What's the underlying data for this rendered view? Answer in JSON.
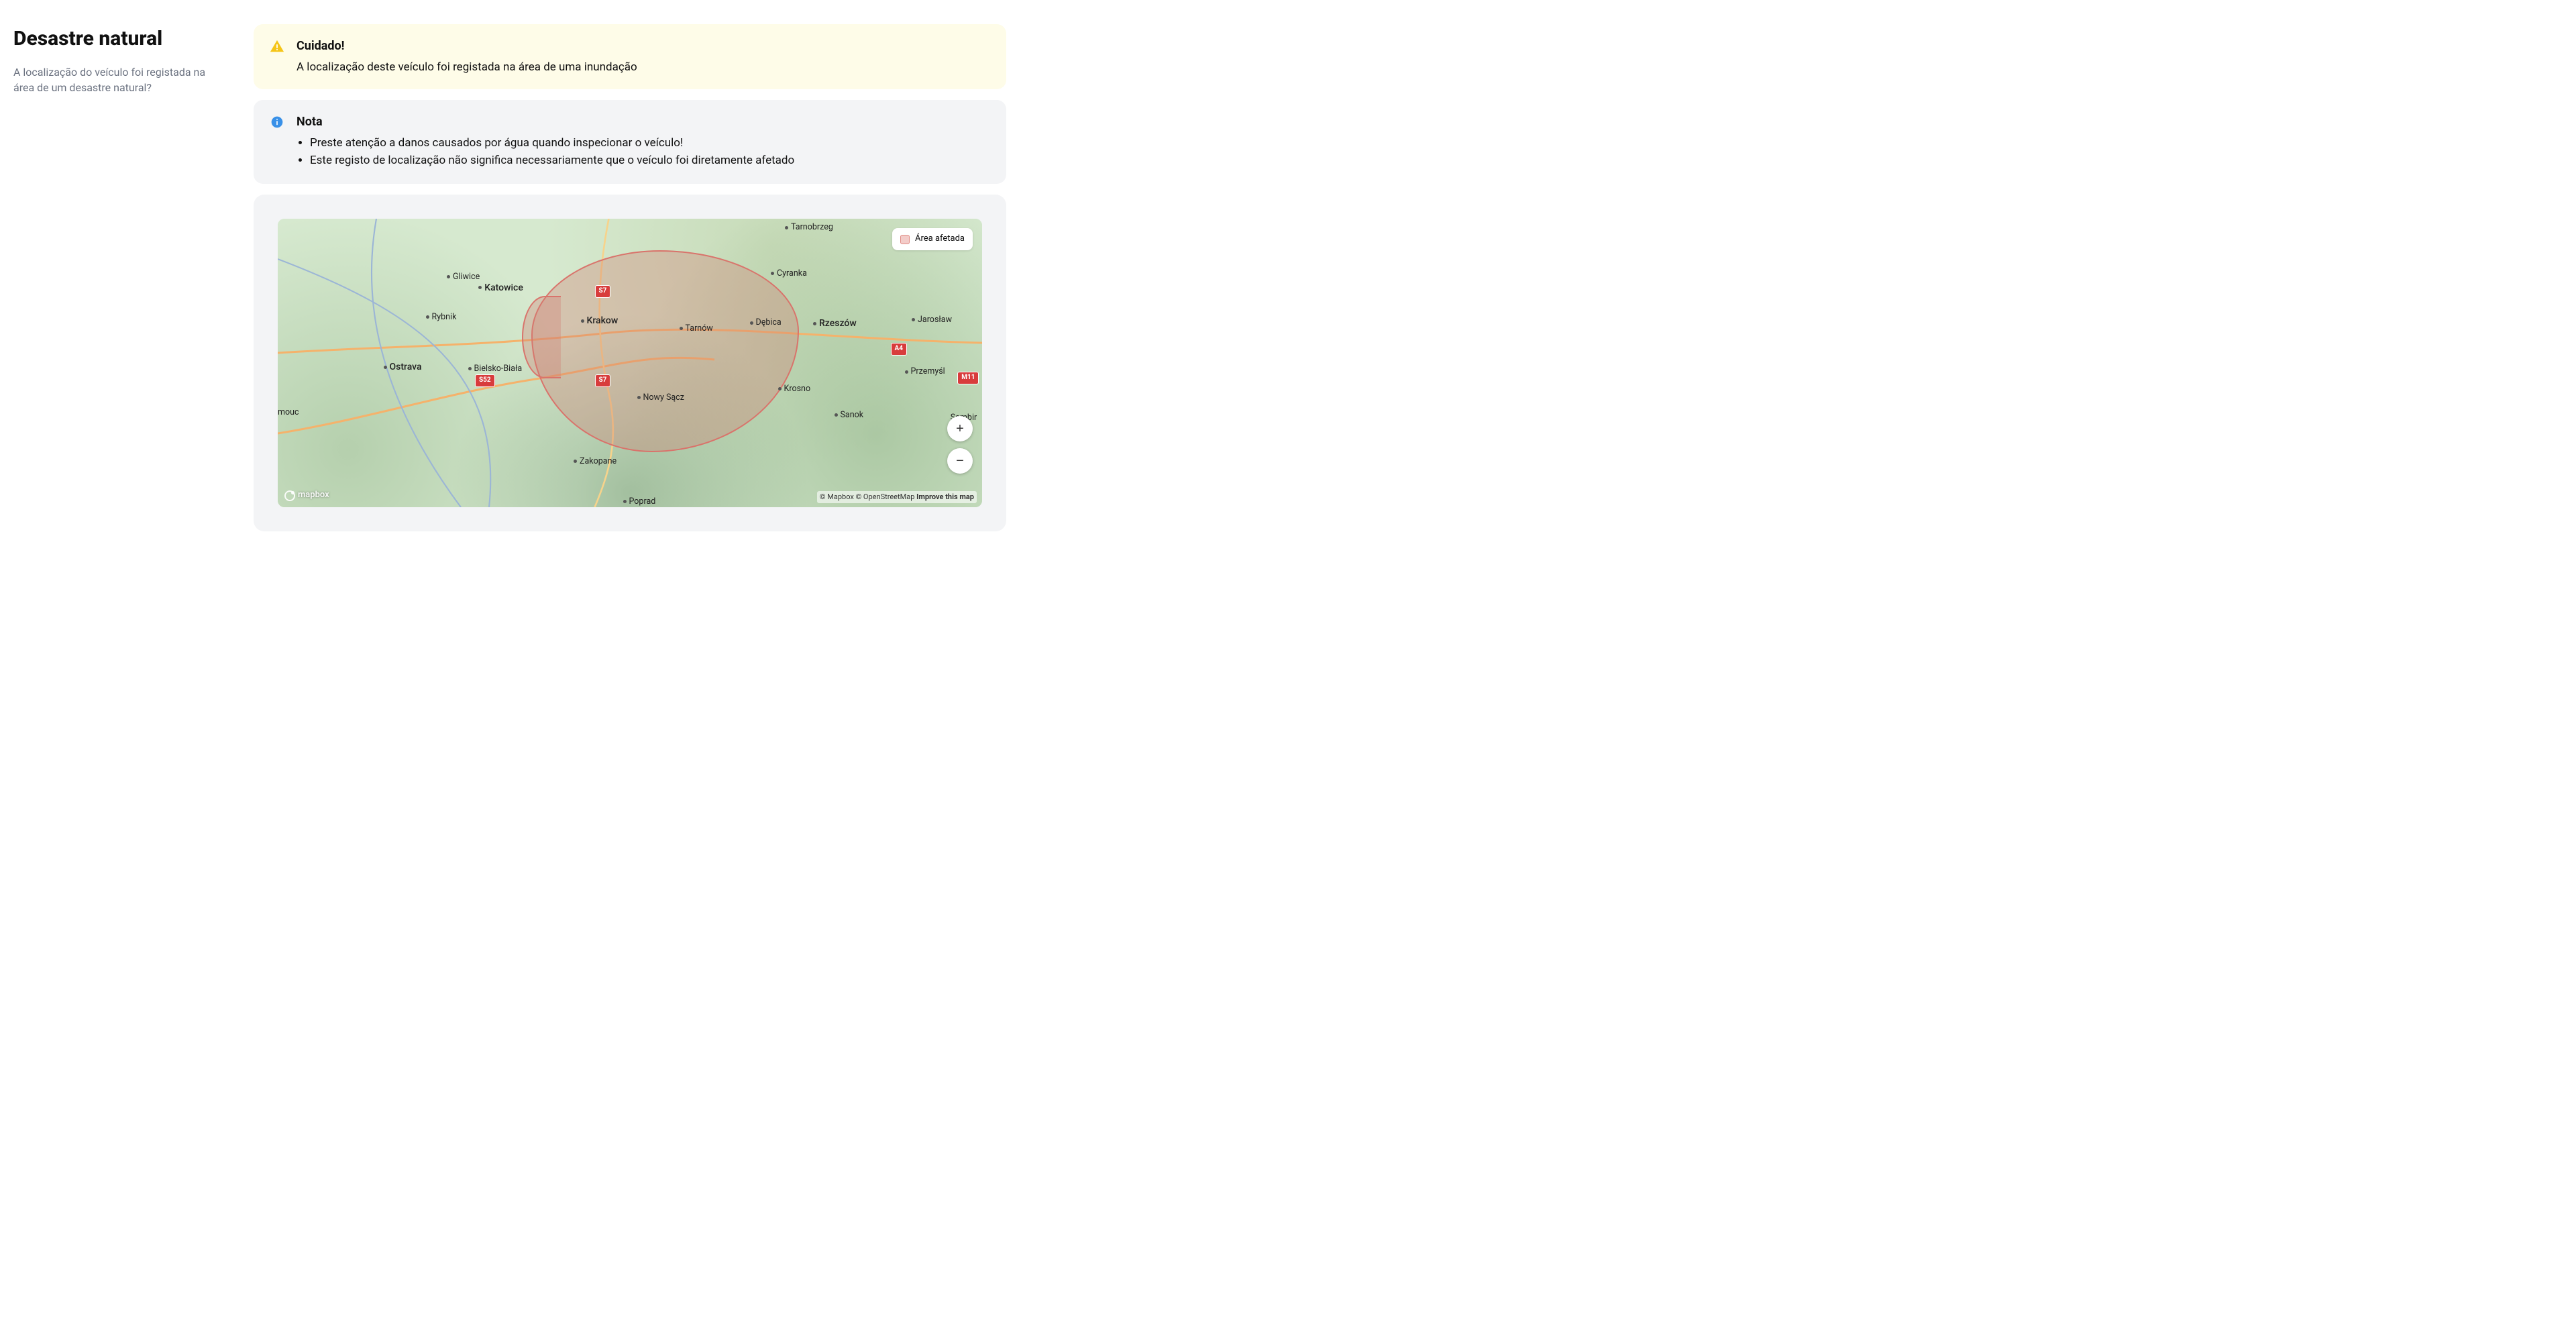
{
  "sidebar": {
    "title": "Desastre natural",
    "subtitle": "A localização do veículo foi registada na área de um desastre natural?"
  },
  "warning": {
    "title": "Cuidado!",
    "text": "A localização deste veículo foi registada na área de uma inundação"
  },
  "note": {
    "title": "Nota",
    "items": [
      "Preste atenção a danos causados por água quando inspecionar o veículo!",
      "Este registo de localização não significa necessariamente que o veículo foi diretamente afetado"
    ]
  },
  "map": {
    "legend_label": "Área afetada",
    "attribution": {
      "mapbox": "© Mapbox",
      "osm": "© OpenStreetMap",
      "improve": "Improve this map"
    },
    "logo_text": "mapbox",
    "zoom_in": "+",
    "zoom_out": "−",
    "road_badges": [
      "S7",
      "S52",
      "S7",
      "A4",
      "M11"
    ],
    "cities": [
      {
        "name": "Tarnobrzeg"
      },
      {
        "name": "Gliwice"
      },
      {
        "name": "Katowice"
      },
      {
        "name": "Cyranka"
      },
      {
        "name": "Rybnik"
      },
      {
        "name": "Krakow"
      },
      {
        "name": "Tarnów"
      },
      {
        "name": "Dębica"
      },
      {
        "name": "Rzeszów"
      },
      {
        "name": "Jarosław"
      },
      {
        "name": "Ostrava"
      },
      {
        "name": "Bielsko-Biała"
      },
      {
        "name": "Przemyśl"
      },
      {
        "name": "Krosno"
      },
      {
        "name": "Nowy Sącz"
      },
      {
        "name": "Sanok"
      },
      {
        "name": "Sambir"
      },
      {
        "name": "Zakopane"
      },
      {
        "name": "Poprad"
      },
      {
        "name": "mouc"
      }
    ]
  }
}
